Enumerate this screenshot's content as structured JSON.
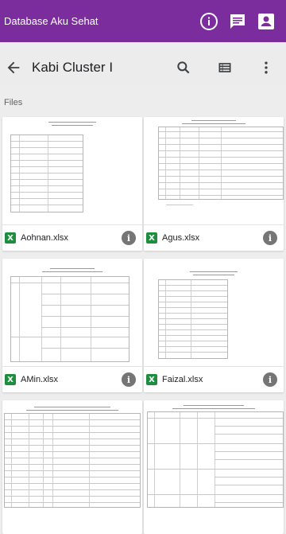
{
  "app": {
    "title": "Database Aku Sehat",
    "actions": [
      "info-icon",
      "comment-icon",
      "account-icon"
    ]
  },
  "toolbar": {
    "breadcrumb": "Kabi Cluster I",
    "icons": [
      "back-arrow-icon",
      "search-icon",
      "list-view-icon",
      "more-vert-icon"
    ]
  },
  "section": {
    "label": "Files"
  },
  "files": [
    {
      "name": "Aohnan.xlsx",
      "type": "xlsx"
    },
    {
      "name": "Agus.xlsx",
      "type": "xlsx"
    },
    {
      "name": "AMin.xlsx",
      "type": "xlsx"
    },
    {
      "name": "Faizal.xlsx",
      "type": "xlsx"
    },
    {
      "name": "",
      "type": "xlsx"
    },
    {
      "name": "",
      "type": "xlsx"
    }
  ],
  "colors": {
    "header": "#7b2d9d",
    "excel": "#1e8e3e",
    "background": "#ededed"
  }
}
